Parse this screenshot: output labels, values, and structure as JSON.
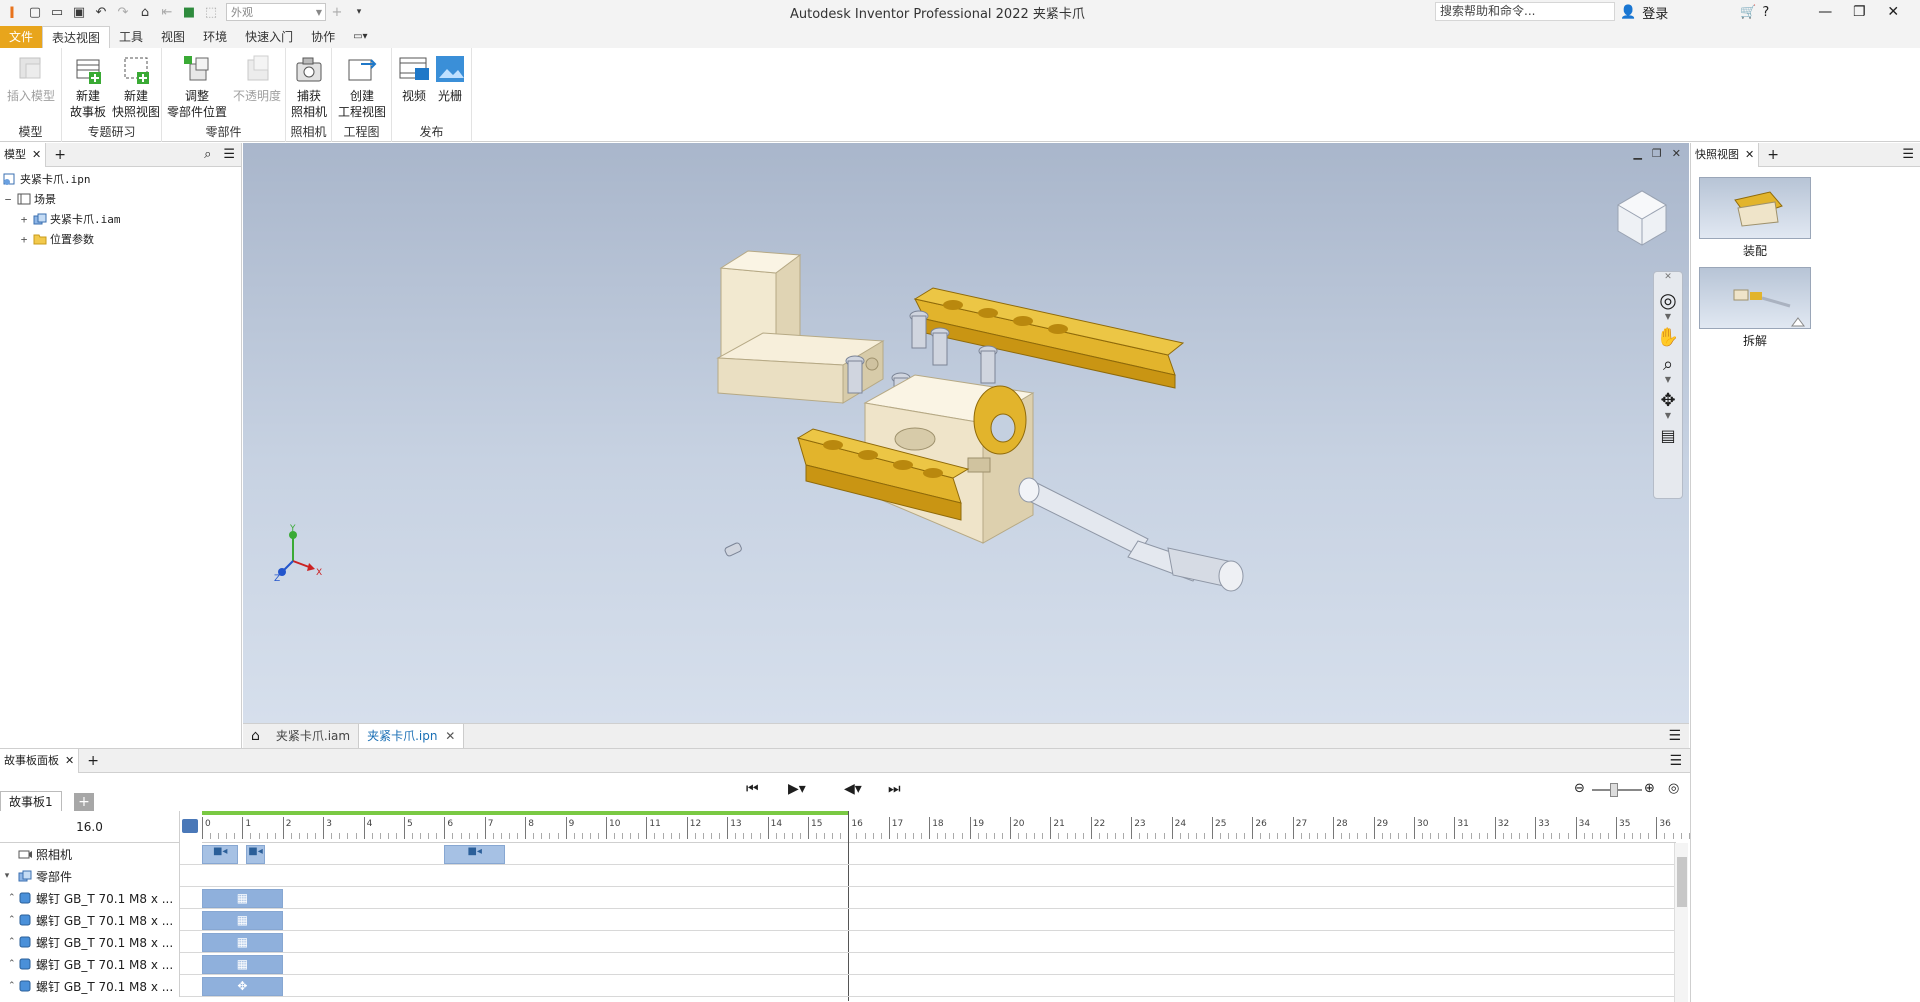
{
  "titlebar": {
    "app_logo": "I",
    "appearance_placeholder": "外观",
    "window_title": "Autodesk Inventor Professional 2022    夹紧卡爪",
    "help_search": "搜索帮助和命令...",
    "login": "登录"
  },
  "ribbon_tabs": [
    "文件",
    "表达视图",
    "工具",
    "视图",
    "环境",
    "快速入门",
    "协作"
  ],
  "ribbon": {
    "insert_model": "插入模型",
    "group_model": "模型",
    "new_storyboard": "新建\n故事板",
    "new_snapshot": "新建\n快照视图",
    "group_topic": "专题研习",
    "tweak_components": "调整\n零部件位置",
    "opacity": "不透明度",
    "group_components": "零部件",
    "capture_camera": "捕获\n照相机",
    "group_camera": "照相机",
    "create_drawing_view": "创建\n工程视图",
    "group_drawing": "工程图",
    "video": "视频",
    "raster": "光栅",
    "group_publish": "发布"
  },
  "browser": {
    "tab_label": "模型",
    "tree": [
      {
        "label": "夹紧卡爪.ipn",
        "indent": 0,
        "toggle": ""
      },
      {
        "label": "场景",
        "indent": 1,
        "toggle": "−"
      },
      {
        "label": "夹紧卡爪.iam",
        "indent": 2,
        "toggle": "+"
      },
      {
        "label": "位置参数",
        "indent": 2,
        "toggle": "+"
      }
    ]
  },
  "doc_tabs": {
    "tab1": "夹紧卡爪.iam",
    "tab2": "夹紧卡爪.ipn"
  },
  "snapshots": {
    "tab_label": "快照视图",
    "items": [
      "装配",
      "拆解"
    ]
  },
  "storyboard": {
    "tab_label": "故事板面板",
    "board_tab": "故事板1",
    "current_time": "16.0",
    "ruler_ticks": [
      "0",
      "1",
      "2",
      "3",
      "4",
      "5",
      "6",
      "7",
      "8",
      "9",
      "10",
      "11",
      "12",
      "13",
      "14",
      "15",
      "16",
      "17",
      "18",
      "19",
      "20",
      "21",
      "22",
      "23",
      "24",
      "25",
      "26",
      "27",
      "28",
      "29",
      "30",
      "31",
      "32",
      "33",
      "34",
      "35",
      "36"
    ],
    "tracks": [
      {
        "label": "照相机",
        "kind": "camera"
      },
      {
        "label": "零部件",
        "kind": "group"
      },
      {
        "label": "螺钉 GB_T 70.1 M8 x ...",
        "kind": "part"
      },
      {
        "label": "螺钉 GB_T 70.1 M8 x ...",
        "kind": "part"
      },
      {
        "label": "螺钉 GB_T 70.1 M8 x ...",
        "kind": "part"
      },
      {
        "label": "螺钉 GB_T 70.1 M8 x ...",
        "kind": "part"
      },
      {
        "label": "螺钉 GB_T 70.1 M8 x ...",
        "kind": "part"
      }
    ]
  },
  "colors": {
    "file_tab": "#e8a51c",
    "viewport_top": "#a9b6cb",
    "viewport_bottom": "#d6dfec",
    "clip": "#a6c1e4",
    "progress": "#7ac943",
    "part_yellow": "#d4a21a",
    "part_cream": "#efe4c9"
  }
}
